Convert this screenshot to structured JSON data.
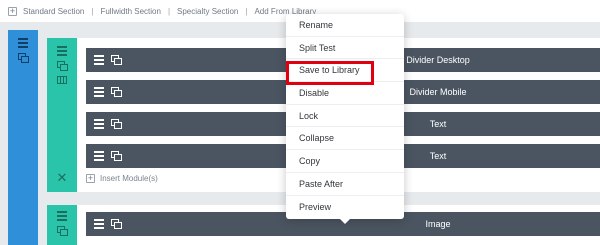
{
  "toolbar": {
    "items": [
      "Standard Section",
      "Fullwidth Section",
      "Specialty Section",
      "Add From Library"
    ],
    "separator": "|",
    "plus": "+"
  },
  "modules": [
    {
      "label": "Divider Desktop"
    },
    {
      "label": "Divider Mobile"
    },
    {
      "label": "Text"
    },
    {
      "label": "Text"
    },
    {
      "label": "Image"
    }
  ],
  "insert_module": {
    "label": "Insert Module(s)",
    "plus": "+"
  },
  "row_close": "✕",
  "context_menu": {
    "items": [
      "Rename",
      "Split Test",
      "Save to Library",
      "Disable",
      "Lock",
      "Collapse",
      "Copy",
      "Paste After",
      "Preview"
    ],
    "highlighted": "Save to Library"
  },
  "colors": {
    "section": "#2f8fd8",
    "row": "#29c4a9",
    "module": "#4b5561",
    "highlight": "#e0000f"
  },
  "icons": [
    "hamburger-icon",
    "duplicate-icon",
    "columns-icon",
    "plus-icon",
    "close-icon"
  ]
}
